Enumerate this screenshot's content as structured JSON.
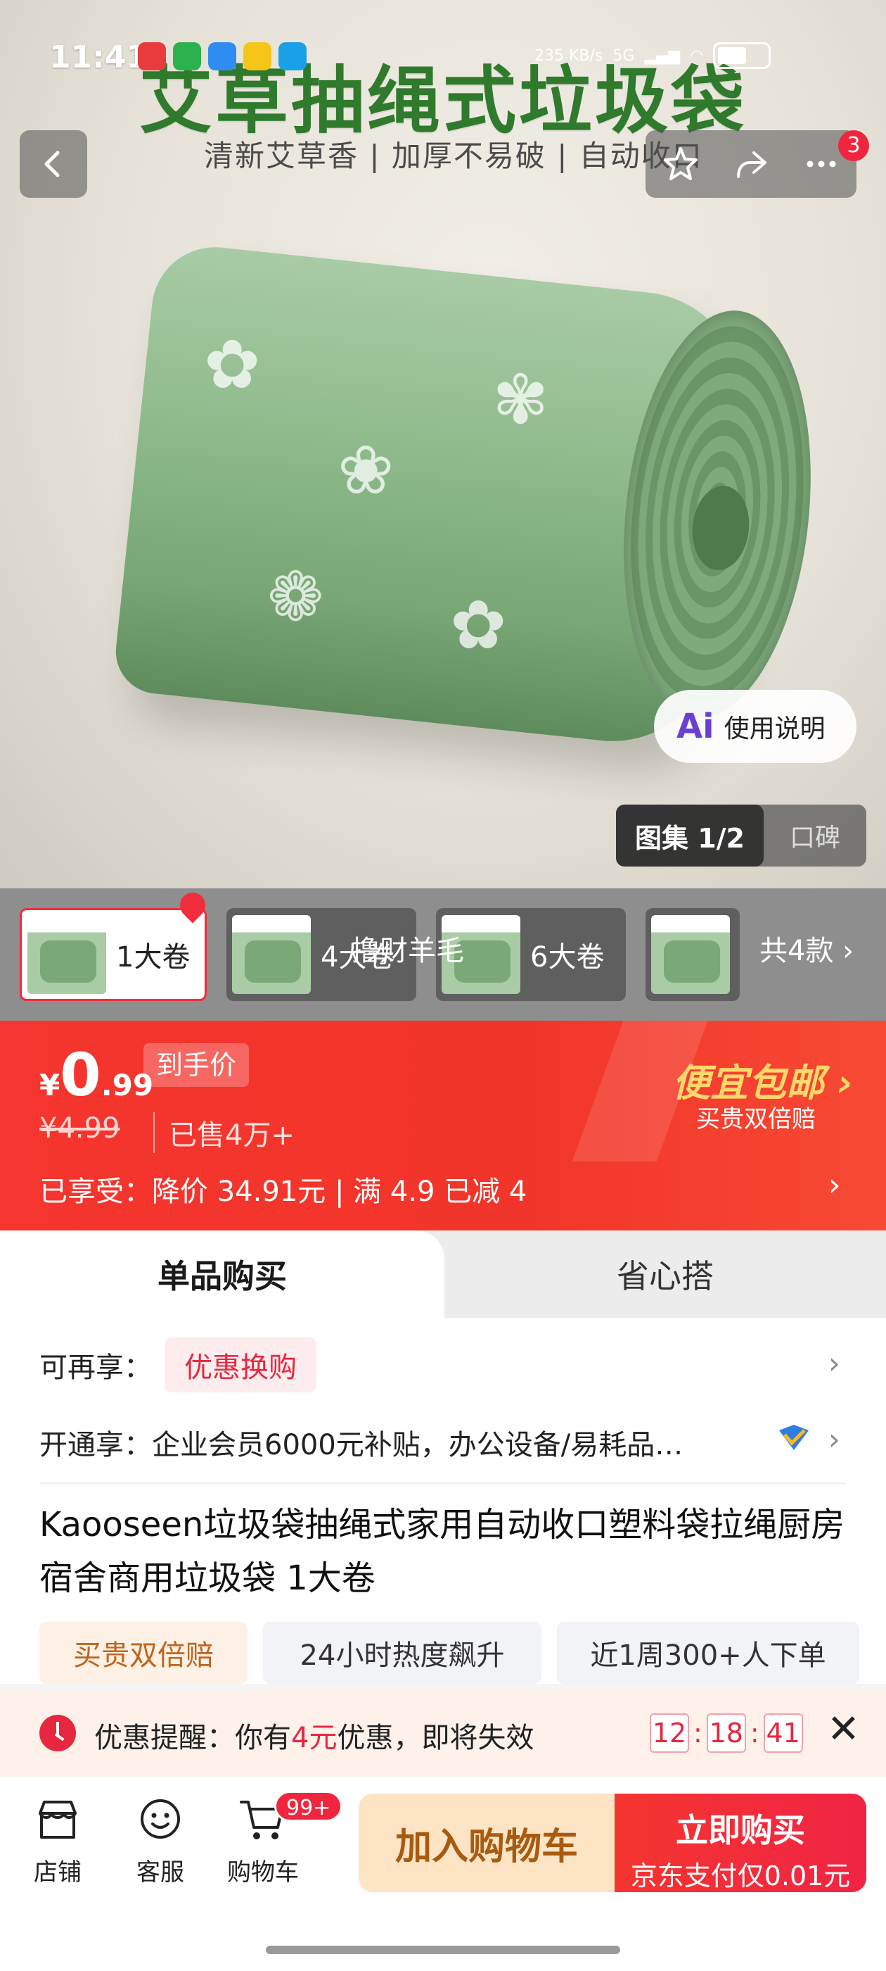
{
  "status_bar": {
    "time": "11:41",
    "speed": "235 KB/s",
    "network": "5G"
  },
  "hero": {
    "title": "艾草抽绳式垃圾袋",
    "subtitle": "清新艾草香 | 加厚不易破 | 自动收口",
    "cart_badge": "3",
    "ai_pill": {
      "mark": "Ai",
      "label": "使用说明"
    },
    "gallery": {
      "active": "图集 1/2",
      "other": "口碑"
    }
  },
  "variants": {
    "items": [
      {
        "label": "1大卷",
        "selected": true
      },
      {
        "label": "4大卷",
        "selected": false
      },
      {
        "label": "6大卷",
        "selected": false
      },
      {
        "label": "",
        "selected": false
      }
    ],
    "overlay_tip": "撸财羊毛",
    "count": "共4款 ›"
  },
  "price": {
    "yen": "¥",
    "integer": "0",
    "decimal": ".99",
    "tag": "到手价",
    "original": "¥4.99",
    "sold": "已售4万+",
    "promo": "已享受：降价 34.91元 | 满 4.9 已减 4",
    "free_ship": "便宜包邮 ›",
    "free_ship_sub": "买贵双倍赔"
  },
  "tabs": {
    "single": "单品购买",
    "combo": "省心搭"
  },
  "info": {
    "extra_label": "可再享：",
    "extra_coupon": "优惠换购",
    "open_label": "开通享：",
    "open_text": "企业会员6000元补贴，办公设备/易耗品…",
    "title": "Kaooseen垃圾袋抽绳式家用自动收口塑料袋拉绳厨房宿舍商用垃圾袋 1大卷",
    "chips": [
      "买贵双倍赔",
      "24小时热度飙升",
      "近1周300+人下单"
    ]
  },
  "reminder": {
    "prefix": "优惠提醒：你有",
    "amount": "4元",
    "suffix": "优惠，即将失效",
    "hh": "12",
    "mm": "18",
    "ss": "41"
  },
  "bottom": {
    "shop": "店铺",
    "service": "客服",
    "cart": "购物车",
    "cart_badge": "99+",
    "add_cart": "加入购物车",
    "buy_now": "立即购买",
    "buy_sub": "京东支付仅0.01元"
  },
  "colors": {
    "brand_red": "#f5352f",
    "accent_gold": "#ffd86b",
    "hero_green": "#2f7a2c"
  }
}
